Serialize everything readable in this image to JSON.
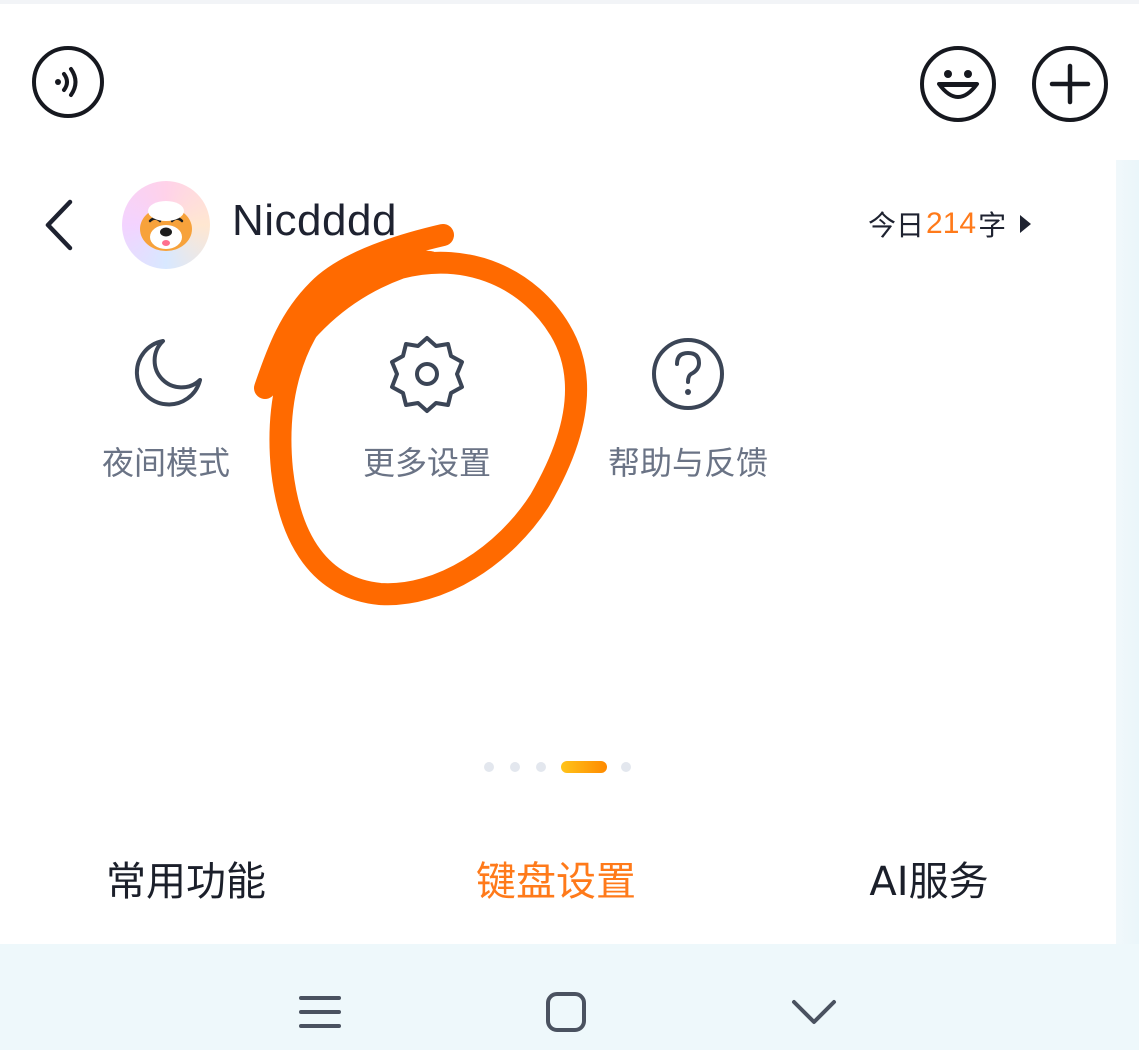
{
  "toolbar": {
    "voice_icon": "voice-wave-icon",
    "emoji_icon": "smiley-icon",
    "add_icon": "plus-icon"
  },
  "header": {
    "back_icon": "chevron-left-icon",
    "username": "Nicdddd",
    "today_prefix": "今日",
    "today_count": "214",
    "today_suffix": "字"
  },
  "features": [
    {
      "label": "夜间模式",
      "icon": "moon-icon"
    },
    {
      "label": "更多设置",
      "icon": "gear-icon"
    },
    {
      "label": "帮助与反馈",
      "icon": "help-circle-icon"
    }
  ],
  "pager": {
    "count": 5,
    "active_index": 3
  },
  "tabs": [
    {
      "label": "常用功能",
      "active": false
    },
    {
      "label": "键盘设置",
      "active": true
    },
    {
      "label": "AI服务",
      "active": false
    }
  ],
  "colors": {
    "accent": "#ff7a1a",
    "annotation": "#ff6a00",
    "label_gray": "#6a7385",
    "icon_stroke": "#3b4556"
  },
  "system_nav": {
    "menu_icon": "menu-icon",
    "home_icon": "square-home-icon",
    "back_icon": "chevron-down-icon"
  }
}
